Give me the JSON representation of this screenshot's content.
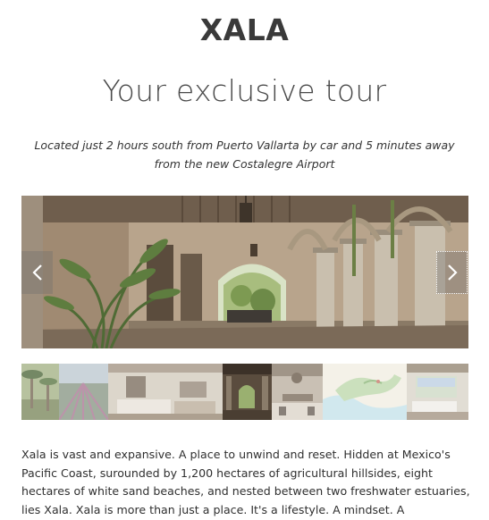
{
  "brand": "XALA",
  "headline": "Your exclusive tour",
  "subtitle": "Located just 2 hours south from Puerto Vallarta by car and 5 minutes away from the new Costalegre Airport",
  "carousel": {
    "prev_icon": "chevron-left-icon",
    "next_icon": "chevron-right-icon",
    "current_slide": 4,
    "thumbnails": [
      "palm-garden-thumbnail",
      "agave-field-thumbnail",
      "living-room-thumbnail",
      "hacienda-corridor-thumbnail",
      "dining-room-thumbnail",
      "coastline-map-thumbnail",
      "bedroom-view-thumbnail"
    ]
  },
  "body": "Xala is vast and expansive. A place to unwind and reset. Hidden at Mexico's Pacific Coast, surounded by 1,200 hectares of agricultural hillsides, eight hectares of white sand beaches, and nested between two freshwater estuaries, lies Xala. Xala is more than just a place. It's a lifestyle. A mindset. A movement."
}
